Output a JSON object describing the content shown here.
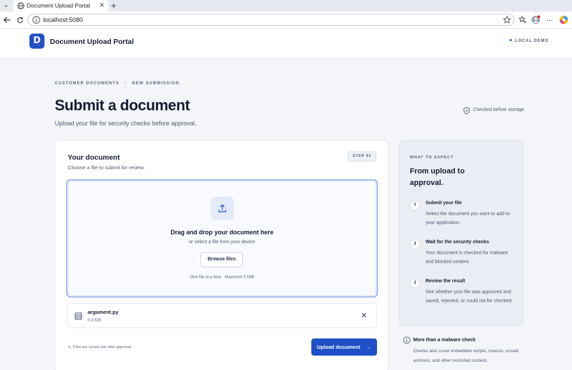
{
  "browser": {
    "tab_title": "Document Upload Portal",
    "url": "localhost:5080"
  },
  "header": {
    "logo_letter": "D",
    "app_title": "Document Upload Portal",
    "env_badge": "LOCAL DEMO"
  },
  "page": {
    "breadcrumb": [
      "CUSTOMER DOCUMENTS",
      "NEW SUBMISSION"
    ],
    "breadcrumb_sep": "/",
    "title": "Submit a document",
    "subtitle": "Upload your file for security checks before approval.",
    "storage_note": "Checked before storage"
  },
  "card": {
    "title": "Your document",
    "subtitle": "Choose a file to submit for review.",
    "step_badge": "STEP 01",
    "dropzone": {
      "title": "Drag and drop your document here",
      "subtitle": "or select a file from your device",
      "browse_label": "Browse files",
      "limit": "One file at a time · Maximum 5 MiB"
    },
    "file": {
      "name": "argument.py",
      "size": "0.3 KiB",
      "remove_glyph": "✕"
    },
    "save_note": "Files are saved only after approval.",
    "upload_label": "Upload document",
    "upload_arrow": "→"
  },
  "side": {
    "kicker": "WHAT TO EXPECT",
    "title": "From upload to approval.",
    "steps": [
      {
        "num": "1",
        "title": "Submit your file",
        "desc": "Select the document you want to add to your application."
      },
      {
        "num": "2",
        "title": "Wait for the security checks",
        "desc": "Your document is checked for malware and blocked content."
      },
      {
        "num": "3",
        "title": "Review the result",
        "desc": "See whether your file was approved and saved, rejected, or could not be checked."
      }
    ],
    "info_title": "More than a malware check",
    "info_desc": "Checks also cover embedded scripts, macros, unsafe archives, and other restricted content."
  },
  "colors": {
    "accent": "#1f50c8",
    "page_bg": "#f3f5f8",
    "heading": "#141d33"
  }
}
